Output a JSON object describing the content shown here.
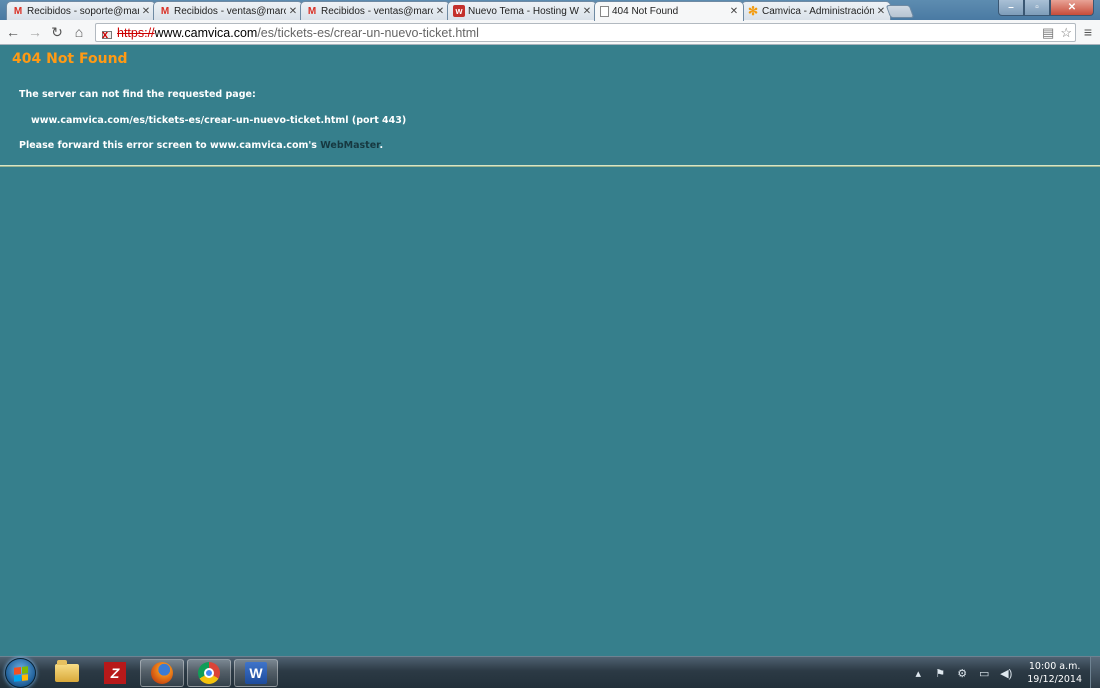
{
  "tabs": [
    {
      "title": "Recibidos - soporte@marc",
      "favicon": "gmail-icon"
    },
    {
      "title": "Recibidos - ventas@marc",
      "favicon": "gmail-icon"
    },
    {
      "title": "Recibidos - ventas@marc",
      "favicon": "gmail-icon"
    },
    {
      "title": "Nuevo Tema - Hosting W",
      "favicon": "webhosting-icon"
    },
    {
      "title": "404 Not Found",
      "favicon": "document-icon",
      "active": true
    },
    {
      "title": "Camvica - Administración",
      "favicon": "joomla-icon"
    }
  ],
  "omnibox": {
    "scheme": "https://",
    "host": "www.camvica.com",
    "path": "/es/tickets-es/crear-un-nuevo-ticket.html"
  },
  "page": {
    "heading": "404 Not Found",
    "line1": "The server can not find the requested page:",
    "line2": "www.camvica.com/es/tickets-es/crear-un-nuevo-ticket.html (port 443)",
    "line3_prefix": "Please forward this error screen to www.camvica.com's",
    "line3_link": "WebMaster",
    "line3_suffix": "."
  },
  "taskbar": {
    "items": [
      "windows-explorer",
      "filezilla",
      "firefox",
      "chrome",
      "word"
    ],
    "clock_time": "10:00 a.m.",
    "clock_date": "19/12/2014"
  },
  "colors": {
    "page_background": "#367f8c",
    "heading": "#ff9a15",
    "text": "#ffffff",
    "link": "#163840"
  }
}
